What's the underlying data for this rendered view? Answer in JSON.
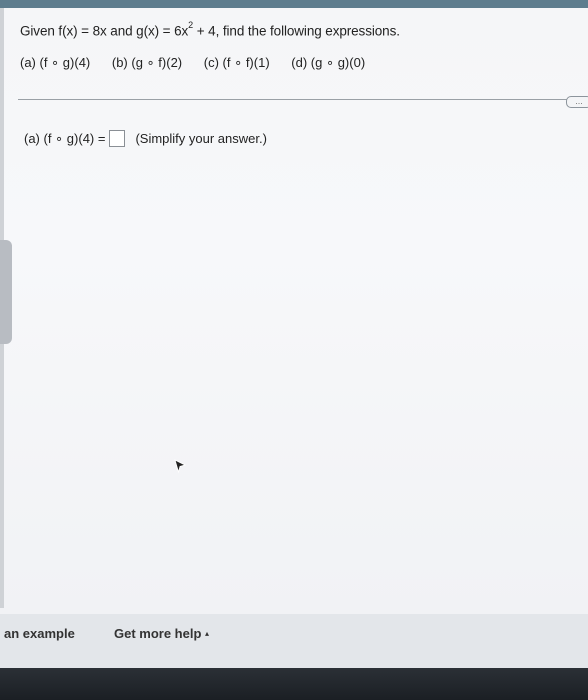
{
  "question": {
    "lead": "Given f(x) = 8x and g(x) = 6x",
    "exp": "2",
    "tail": " + 4, find the following expressions."
  },
  "parts": [
    "(a) (f ∘ g)(4)",
    "(b) (g ∘ f)(2)",
    "(c) (f ∘ f)(1)",
    "(d) (g ∘ g)(0)"
  ],
  "answer": {
    "label": "(a) (f ∘ g)(4) =",
    "hint": "(Simplify your answer.)"
  },
  "more_button": "…",
  "footer": {
    "example": "an example",
    "more_help": "Get more help",
    "more_help_arrow": "▴"
  }
}
